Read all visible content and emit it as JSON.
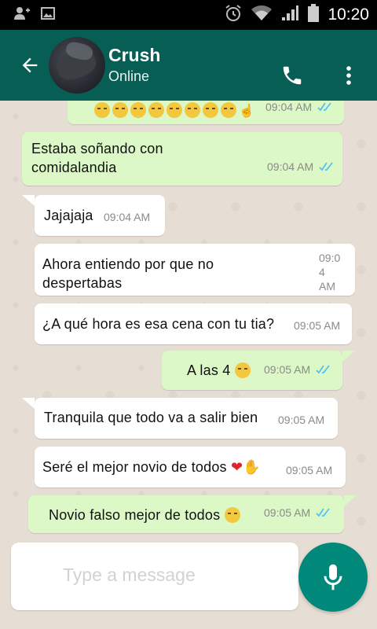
{
  "status_bar": {
    "time": "10:20"
  },
  "header": {
    "contact_name": "Crush",
    "contact_status": "Online"
  },
  "messages": [
    {
      "direction": "out",
      "text": "",
      "time": "09:04 AM",
      "read": true,
      "partial": true
    },
    {
      "direction": "out",
      "line1": "Estaba soñando con",
      "line2": "comidalandia",
      "time": "09:04 AM",
      "read": true
    },
    {
      "direction": "in",
      "text": "Jajajaja",
      "time": "09:04 AM"
    },
    {
      "direction": "in",
      "line1": "Ahora entiendo por que no",
      "line2": "despertabas",
      "time_l1": "09:0",
      "time_l2": "4",
      "time_l3": "AM"
    },
    {
      "direction": "in",
      "text": "¿A qué hora es esa cena con tu tia?",
      "time": "09:05 AM"
    },
    {
      "direction": "out",
      "text": "A las 4",
      "time": "09:05 AM",
      "read": true
    },
    {
      "direction": "in",
      "text": "Tranquila que todo va a salir bien",
      "time": "09:05 AM"
    },
    {
      "direction": "in",
      "text": "Seré el mejor novio de todos",
      "time": "09:05 AM"
    },
    {
      "direction": "out",
      "text": "Novio falso mejor de todos",
      "time": "09:05 AM",
      "read": true
    }
  ],
  "input": {
    "placeholder": "Type a message"
  },
  "colors": {
    "header": "#075e54",
    "outgoing": "#dcf8c6",
    "incoming": "#ffffff",
    "mic": "#00897b",
    "ticks": "#4fc3f7"
  }
}
